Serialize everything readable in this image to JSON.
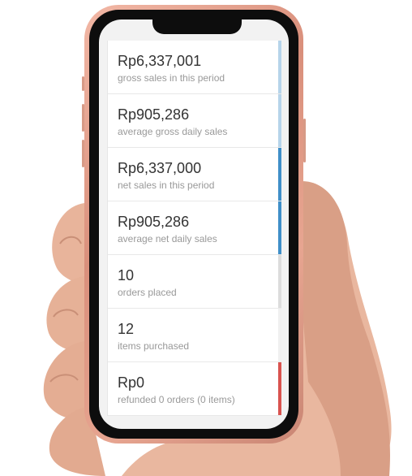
{
  "stats": [
    {
      "value": "Rp6,337,001",
      "label": "gross sales in this period",
      "bar_color": "#b6d4ea"
    },
    {
      "value": "Rp905,286",
      "label": "average gross daily sales",
      "bar_color": "#b6d4ea"
    },
    {
      "value": "Rp6,337,000",
      "label": "net sales in this period",
      "bar_color": "#3f8fc8"
    },
    {
      "value": "Rp905,286",
      "label": "average net daily sales",
      "bar_color": "#3f8fc8"
    },
    {
      "value": "10",
      "label": "orders placed",
      "bar_color": "#dcdcdc"
    },
    {
      "value": "12",
      "label": "items purchased",
      "bar_color": "#f0f0f0"
    },
    {
      "value": "Rp0",
      "label": "refunded 0 orders (0 items)",
      "bar_color": "#d9534f"
    }
  ]
}
